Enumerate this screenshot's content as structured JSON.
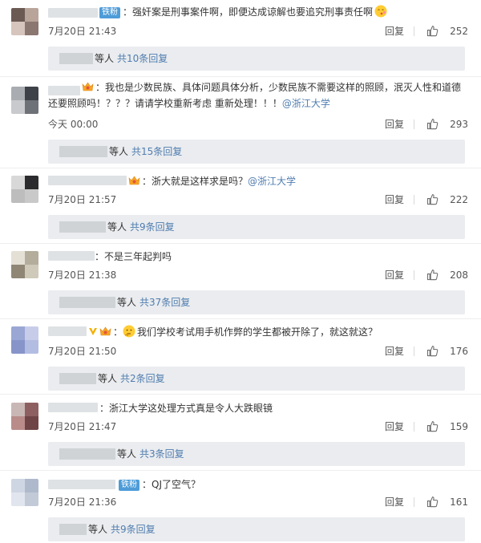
{
  "comments": [
    {
      "badge": "铁粉",
      "text": "：强奸案是刑事案件啊，即便达成谅解也要追究刑事责任啊",
      "text_link": "",
      "time": "7月20日 21:43",
      "reply": "回复",
      "likes": "252",
      "sub_suffix": "等人",
      "sub_total": "共10条回复",
      "avatar_colors": [
        "#6b5a54",
        "#b9a49a",
        "#d6c5bc",
        "#8a7770"
      ]
    },
    {
      "badge": "",
      "text": "：我也是少数民族、具体问题具体分析，少数民族不需要这样的照顾，泯灭人性和道德还要照顾吗！？？？请请学校重新考虑 重新处理！！！",
      "text_link": "@浙江大学",
      "time": "今天 00:00",
      "reply": "回复",
      "likes": "293",
      "sub_suffix": "等人",
      "sub_total": "共15条回复",
      "avatar_colors": [
        "#a9acb0",
        "#3e4148",
        "#c8cacd",
        "#6e7177"
      ]
    },
    {
      "badge": "",
      "text": "：浙大就是这样求是吗？",
      "text_link": "@浙江大学",
      "time": "7月20日 21:57",
      "reply": "回复",
      "likes": "222",
      "sub_suffix": "等人",
      "sub_total": "共9条回复",
      "avatar_colors": [
        "#d8d8d8",
        "#2b2b2d",
        "#bdbdbd",
        "#c9c9c9"
      ]
    },
    {
      "badge": "",
      "text": "：不是三年起判吗",
      "text_link": "",
      "time": "7月20日 21:38",
      "reply": "回复",
      "likes": "208",
      "sub_suffix": "等人",
      "sub_total": "共37条回复",
      "avatar_colors": [
        "#e4e0d6",
        "#b4ad9c",
        "#8f8676",
        "#cfc9b9"
      ]
    },
    {
      "badge": "",
      "text": "我们学校考试用手机作弊的学生都被开除了，就这就这？",
      "text_link": "",
      "time": "7月20日 21:50",
      "reply": "回复",
      "likes": "176",
      "sub_suffix": "等人",
      "sub_total": "共2条回复",
      "avatar_colors": [
        "#9aa7d4",
        "#c7cde8",
        "#8794c9",
        "#b3bde2"
      ]
    },
    {
      "badge": "",
      "text": "：浙江大学这处理方式真是令人大跌眼镜",
      "text_link": "",
      "time": "7月20日 21:47",
      "reply": "回复",
      "likes": "159",
      "sub_suffix": "等人",
      "sub_total": "共3条回复",
      "avatar_colors": [
        "#c9b7b6",
        "#8e5f60",
        "#b98c8a",
        "#6f4446"
      ]
    },
    {
      "badge": "铁粉",
      "text": "：QJ了空气？",
      "text_link": "",
      "time": "7月20日 21:36",
      "reply": "回复",
      "likes": "161",
      "sub_suffix": "等人",
      "sub_total": "共9条回复",
      "avatar_colors": [
        "#cfd6e3",
        "#aeb9cc",
        "#e1e5ee",
        "#c2cad8"
      ]
    }
  ],
  "colors": {
    "link": "#507daf",
    "badge": "#4e9cd8",
    "sub_bg": "#eaecef",
    "name_blur": "#dfe2e4"
  },
  "icons": {
    "like": "thumbs-up-icon",
    "crown": "crown-badge-icon",
    "verified": "yellow-v-icon",
    "emoji_kiss": "emoji-kiss-icon",
    "emoji_think": "emoji-thinking-icon"
  }
}
